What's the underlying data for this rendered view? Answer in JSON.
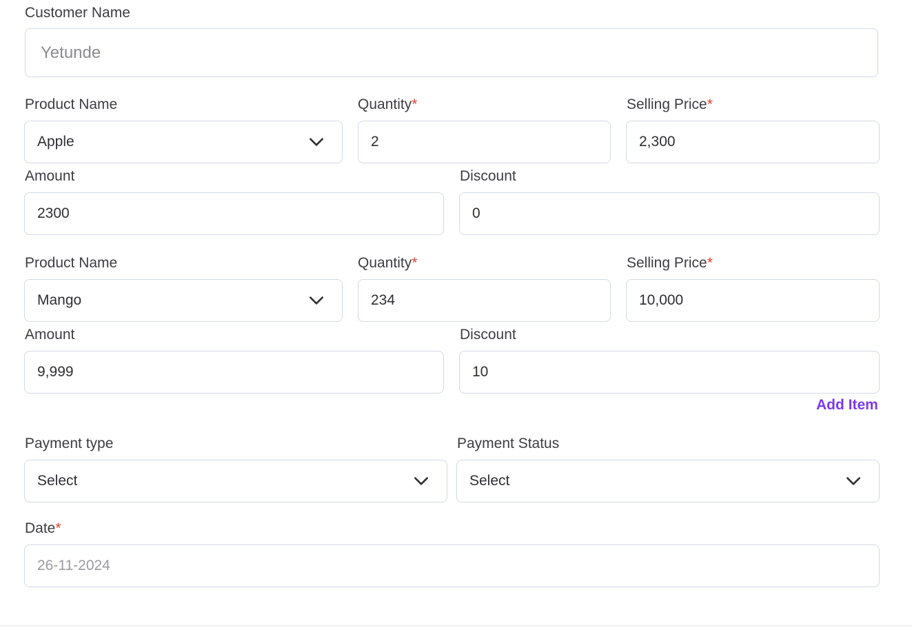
{
  "customer": {
    "label": "Customer Name",
    "value": "Yetunde"
  },
  "items": [
    {
      "product_label": "Product Name",
      "product_value": "Apple",
      "quantity_label": "Quantity",
      "quantity_value": "2",
      "price_label": "Selling Price",
      "price_value": "2,300",
      "amount_label": "Amount",
      "amount_value": "2300",
      "discount_label": "Discount",
      "discount_value": "0"
    },
    {
      "product_label": "Product Name",
      "product_value": "Mango",
      "quantity_label": "Quantity",
      "quantity_value": "234",
      "price_label": "Selling Price",
      "price_value": "10,000",
      "amount_label": "Amount",
      "amount_value": "9,999",
      "discount_label": "Discount",
      "discount_value": "10"
    }
  ],
  "required_marker": "*",
  "add_item_label": "Add Item",
  "payment": {
    "type_label": "Payment type",
    "type_value": "Select",
    "status_label": "Payment Status",
    "status_value": "Select"
  },
  "date": {
    "label": "Date",
    "value": "26-11-2024"
  },
  "icons": {
    "dropdown": "chevron-down-icon"
  },
  "colors": {
    "accent": "#7c3aed",
    "required": "#e0402f",
    "border": "#d3d9e6"
  }
}
